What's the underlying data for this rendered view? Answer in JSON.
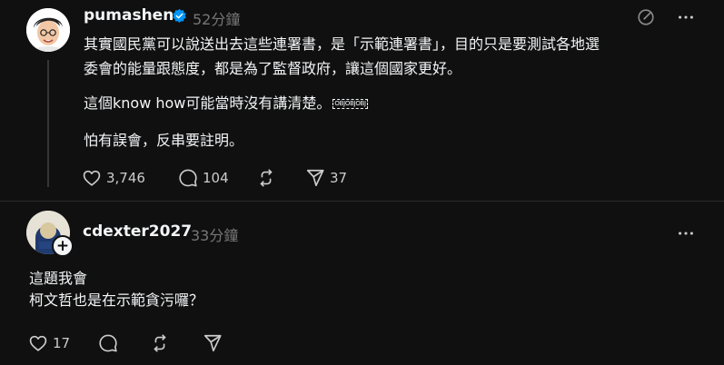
{
  "post1": {
    "username": "pumashen",
    "time": "52分鐘",
    "verified": true,
    "lines": [
      "其實國民黨可以說送出去這些連署書，是「示範連署書」，目的只是要測試各地選",
      "委會的能量跟態度，都是為了監督政府，讓這個國家更好。"
    ],
    "line3": "這個know how可能當時沒有講清楚。",
    "line3_obj": "OBJOBJOBJ",
    "line4": "怕有誤會，反串要註明。",
    "actions": {
      "likes": "3,746",
      "comments": "104",
      "shares": "37"
    }
  },
  "post2": {
    "username": "cdexter2027",
    "time": "33分鐘",
    "lines": [
      "這題我會",
      "柯文哲也是在示範貪污囉？"
    ],
    "actions": {
      "likes": "17"
    }
  },
  "icons": {
    "verified": "verified-badge-icon",
    "activity": "activity-icon",
    "more": "more-icon",
    "like": "heart-icon",
    "comment": "comment-icon",
    "repost": "repost-icon",
    "share": "send-icon",
    "follow": "plus-icon"
  },
  "colors": {
    "background": "#101010",
    "text": "#f3f5f7",
    "muted": "#777777",
    "verified": "#0095f6"
  }
}
